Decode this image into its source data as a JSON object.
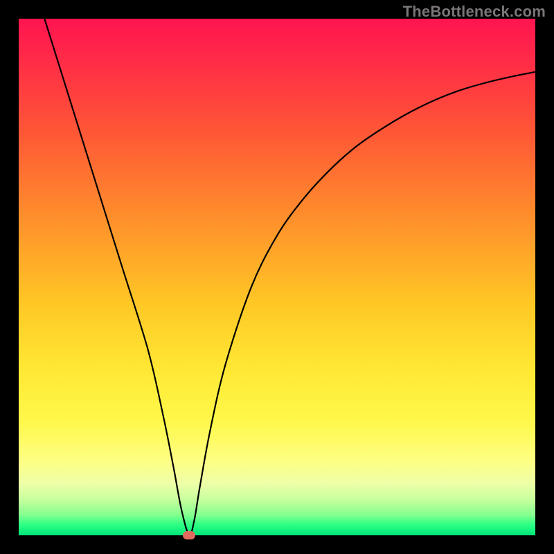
{
  "watermark": "TheBottleneck.com",
  "chart_data": {
    "type": "line",
    "title": "",
    "xlabel": "",
    "ylabel": "",
    "xlim": [
      0,
      100
    ],
    "ylim": [
      0,
      100
    ],
    "series": [
      {
        "name": "curve",
        "x": [
          5,
          10,
          15,
          20,
          25,
          28,
          30,
          31.5,
          33,
          34,
          35,
          37,
          40,
          45,
          50,
          55,
          60,
          65,
          70,
          75,
          80,
          85,
          90,
          95,
          100
        ],
        "y": [
          100,
          84,
          68,
          52,
          36,
          23,
          13,
          5,
          0,
          3,
          9,
          20,
          33,
          48,
          58,
          65,
          70.5,
          75,
          78.5,
          81.5,
          84,
          86,
          87.5,
          88.7,
          89.7
        ]
      }
    ],
    "marker": {
      "x": 33,
      "y": 0,
      "shape": "pill",
      "color": "#e06a5e"
    },
    "background_gradient": [
      "#ff1450",
      "#ffe834",
      "#00e57a"
    ]
  }
}
